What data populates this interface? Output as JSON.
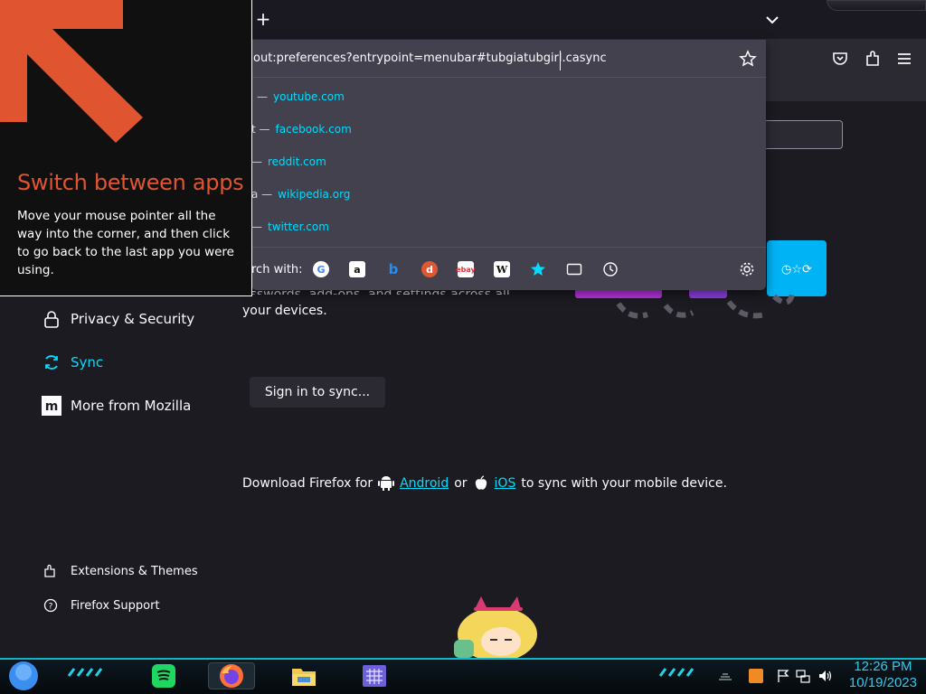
{
  "url_bar": {
    "value": "about:preferences?entrypoint=menubar#tubgiatubgirl.casync",
    "visible_value": "out:preferences?entrypoint=menubar#tubgiatubgirl.casync"
  },
  "suggestions": [
    {
      "prefix": "—",
      "url": "youtube.com"
    },
    {
      "prefix": "t —",
      "url": "facebook.com"
    },
    {
      "prefix": "—",
      "url": "reddit.com"
    },
    {
      "prefix": "a —",
      "url": "wikipedia.org"
    },
    {
      "prefix": "—",
      "url": "twitter.com"
    }
  ],
  "search_engines": {
    "label": "rch with:",
    "items": [
      "google-icon",
      "amazon-icon",
      "bing-icon",
      "duckduckgo-icon",
      "ebay-icon",
      "wikipedia-icon",
      "bookmarks-icon",
      "tabs-icon",
      "history-icon"
    ]
  },
  "tip": {
    "title": "Switch between apps",
    "body": "Move your mouse pointer all the way into the corner, and then click to go back to the last app you were using."
  },
  "sidebar": {
    "items": [
      {
        "label": "Privacy & Security",
        "icon": "lock-icon",
        "active": false
      },
      {
        "label": "Sync",
        "icon": "sync-icon",
        "active": true
      },
      {
        "label": "More from Mozilla",
        "icon": "mozilla-icon",
        "active": false
      }
    ],
    "footer": [
      {
        "label": "Extensions & Themes",
        "icon": "puzzle-icon"
      },
      {
        "label": "Firefox Support",
        "icon": "help-icon"
      }
    ]
  },
  "sync": {
    "desc_cut": "asswords, add-ons, and settings across all",
    "desc_end": "your devices.",
    "signin_label": "Sign in to sync...",
    "download_prefix": "Download Firefox for",
    "android": "Android",
    "or": "or",
    "ios": "iOS",
    "download_suffix": "to sync with your mobile device."
  },
  "taskbar": {
    "time": "12:26 PM",
    "date": "10/19/2023"
  },
  "colors": {
    "accent": "#00ddff",
    "tip_title": "#e0552f",
    "taskbar_accent": "#0fb4c7"
  }
}
